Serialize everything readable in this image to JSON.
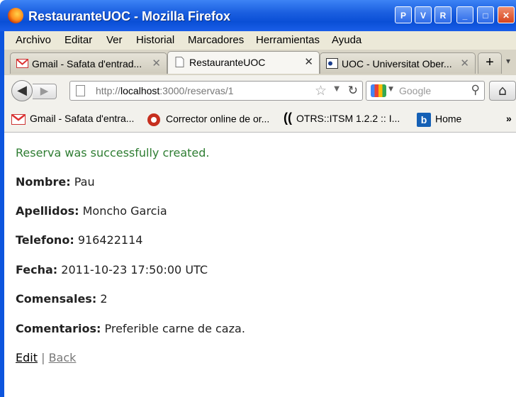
{
  "window": {
    "title": "RestauranteUOC - Mozilla Firefox",
    "controls": [
      "P",
      "V",
      "R",
      "_",
      "□",
      "✕"
    ]
  },
  "menu": [
    "Archivo",
    "Editar",
    "Ver",
    "Historial",
    "Marcadores",
    "Herramientas",
    "Ayuda"
  ],
  "tabs": [
    {
      "label": "Gmail - Safata d'entrad...",
      "icon": "gmail-icon"
    },
    {
      "label": "RestauranteUOC",
      "icon": "page-icon",
      "active": true
    },
    {
      "label": "UOC - Universitat Ober...",
      "icon": "uoc-icon"
    }
  ],
  "tab_new": "+",
  "nav": {
    "url_prefix": "http://",
    "url_host": "localhost",
    "url_rest": ":3000/reservas/1",
    "search_placeholder": "Google"
  },
  "bookmarks": [
    {
      "label": "Gmail - Safata d'entra...",
      "icon": "gmail-icon"
    },
    {
      "label": "Corrector online de or...",
      "icon": "corrector-icon"
    },
    {
      "label": "OTRS::ITSM 1.2.2 :: I...",
      "icon": "otrs-icon"
    },
    {
      "label": "Home",
      "icon": "b-icon"
    }
  ],
  "bookmarks_more": "»",
  "page": {
    "notice": "Reserva was successfully created.",
    "fields": [
      {
        "label": "Nombre:",
        "value": "Pau"
      },
      {
        "label": "Apellidos:",
        "value": "Moncho Garcia"
      },
      {
        "label": "Telefono:",
        "value": "916422114"
      },
      {
        "label": "Fecha:",
        "value": "2011-10-23 17:50:00 UTC"
      },
      {
        "label": "Comensales:",
        "value": "2"
      },
      {
        "label": "Comentarios:",
        "value": "Preferible carne de caza."
      }
    ],
    "edit_link": "Edit",
    "separator": "|",
    "back_link": "Back"
  }
}
